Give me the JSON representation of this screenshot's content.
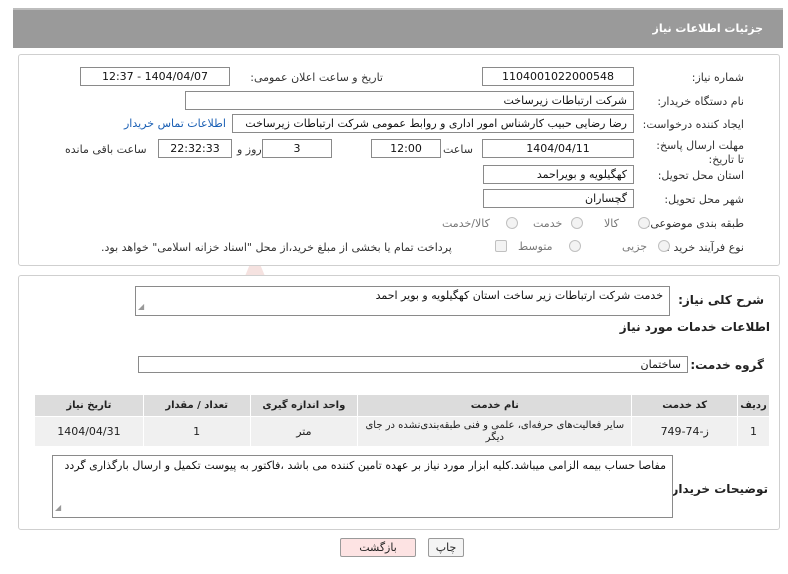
{
  "header": {
    "title": "جزئیات اطلاعات نیاز"
  },
  "need": {
    "need_number_label": "شماره نیاز:",
    "need_number": "1104001022000548",
    "announce_label": "تاریخ و ساعت اعلان عمومی:",
    "announce_value": "1404/04/07 - 12:37",
    "buyer_org_label": "نام دستگاه خریدار:",
    "buyer_org": "شرکت ارتباطات زیرساخت",
    "requester_label": "ایجاد کننده درخواست:",
    "requester": "رضا رضایی حبیب کارشناس امور اداری و روابط عمومی شرکت ارتباطات زیرساخت",
    "contact_link": "اطلاعات تماس خریدار",
    "deadline_label": "مهلت ارسال پاسخ: تا تاریخ:",
    "deadline_date": "1404/04/11",
    "time_label": "ساعت",
    "deadline_time": "12:00",
    "days_value": "3",
    "days_label": "روز و",
    "remaining_time": "22:32:33",
    "remaining_label": "ساعت باقی مانده",
    "province_label": "استان محل تحویل:",
    "province": "کهگیلویه و بویراحمد",
    "city_label": "شهر محل تحویل:",
    "city": "گچساران",
    "category_label": "طبقه بندی موضوعی:",
    "category_options": [
      "کالا",
      "خدمت",
      "کالا/خدمت"
    ],
    "process_label": "نوع فرآیند خرید :",
    "process_options": [
      "جزیی",
      "متوسط"
    ],
    "payment_note": "پرداخت تمام یا بخشی از مبلغ خرید،از محل \"اسناد خزانه اسلامی\" خواهد بود."
  },
  "details": {
    "summary_label": "شرح کلی نیاز:",
    "summary": "خدمت شرکت ارتباطات زیر ساخت استان کهگیلویه و بویر احمد",
    "services_title": "اطلاعات خدمات مورد نیاز",
    "service_group_label": "گروه خدمت:",
    "service_group": "ساختمان",
    "table": {
      "headers": [
        "ردیف",
        "کد خدمت",
        "نام خدمت",
        "واحد اندازه گیری",
        "تعداد / مقدار",
        "تاریخ نیاز"
      ],
      "rows": [
        [
          "1",
          "ز-74-749",
          "سایر فعالیت‌های حرفه‌ای، علمی و فنی طبقه‌بندی‌نشده در جای دیگر",
          "متر",
          "1",
          "1404/04/31"
        ]
      ]
    },
    "buyer_notes_label": "توضیحات خریدار:",
    "buyer_notes": "مفاصا حساب بیمه الزامی میباشد.کلیه ابزار مورد نیاز بر عهده تامین کننده می باشد ،فاکتور به پیوست تکمیل و ارسال بارگذاری گردد"
  },
  "buttons": {
    "print": "چاپ",
    "back": "بازگشت"
  },
  "watermark": {
    "text": "AriaTender.neT"
  },
  "colors": {
    "header_bg": "#9a9a9a",
    "link": "#1a5fb4",
    "table_header_bg": "#dcdcdc",
    "back_button_bg": "#fde3e3",
    "watermark": "#c0392b"
  }
}
